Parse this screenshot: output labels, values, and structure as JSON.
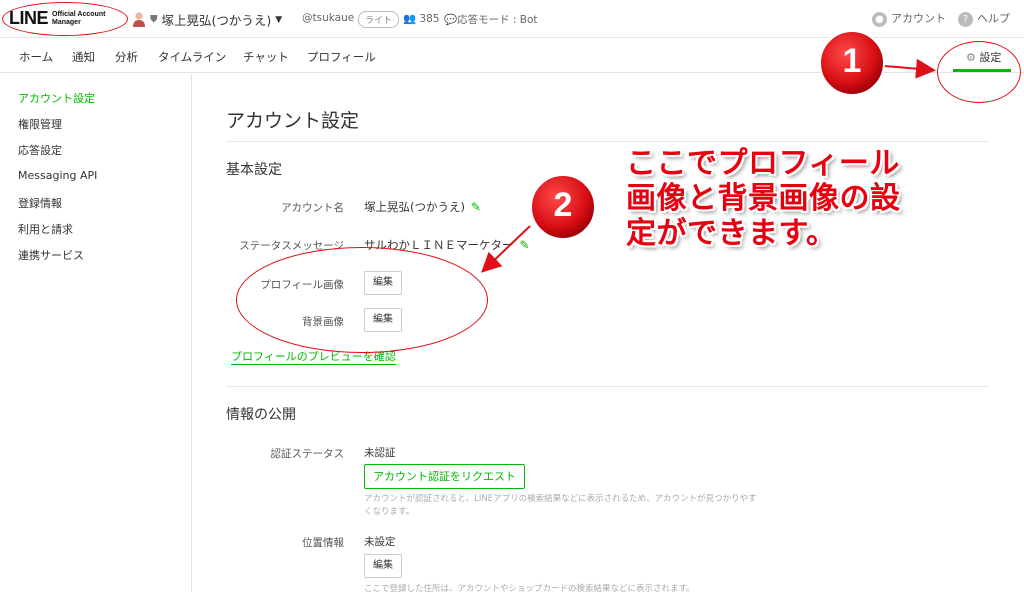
{
  "header": {
    "logo_line": "LINE",
    "logo_sub": "Official Account Manager",
    "account_name": "塚上晃弘(つかうえ)",
    "account_id": "@tsukaue",
    "plan": "ライト",
    "friends": "385",
    "response_mode": "応答モード : Bot",
    "account_link": "アカウント",
    "help_link": "ヘルプ"
  },
  "nav": {
    "items": [
      "ホーム",
      "通知",
      "分析",
      "タイムライン",
      "チャット",
      "プロフィール"
    ],
    "settings": "設定"
  },
  "sidebar": {
    "items": [
      "アカウント設定",
      "権限管理",
      "応答設定",
      "Messaging API",
      "登録情報",
      "利用と請求",
      "連携サービス"
    ]
  },
  "main": {
    "title": "アカウント設定",
    "basic_section": "基本設定",
    "account_name_label": "アカウント名",
    "account_name_value": "塚上晃弘(つかうえ)",
    "status_label": "ステータスメッセージ",
    "status_value": "サルわかＬＩＮＥマーケター",
    "profile_image_label": "プロフィール画像",
    "background_image_label": "背景画像",
    "edit_label": "編集",
    "preview_link": "プロフィールのプレビューを確認",
    "public_section": "情報の公開",
    "verify_label": "認証ステータス",
    "verify_value": "未認証",
    "verify_button": "アカウント認証をリクエスト",
    "verify_help": "アカウントが認証されると、LINEアプリの検索結果などに表示されるため、アカウントが見つかりやすくなります。",
    "location_label": "位置情報",
    "location_value": "未設定",
    "location_help": "ここで登録した住所は、アカウントやショップカードの検索結果などに表示されます。"
  },
  "annotations": {
    "step1": "1",
    "step2": "2",
    "callout_line1": "ここでプロフィール",
    "callout_line2": "画像と背景画像の設",
    "callout_line3": "定ができます。"
  },
  "colors": {
    "brand_green": "#00b900",
    "annotation_red": "#e0101a"
  }
}
